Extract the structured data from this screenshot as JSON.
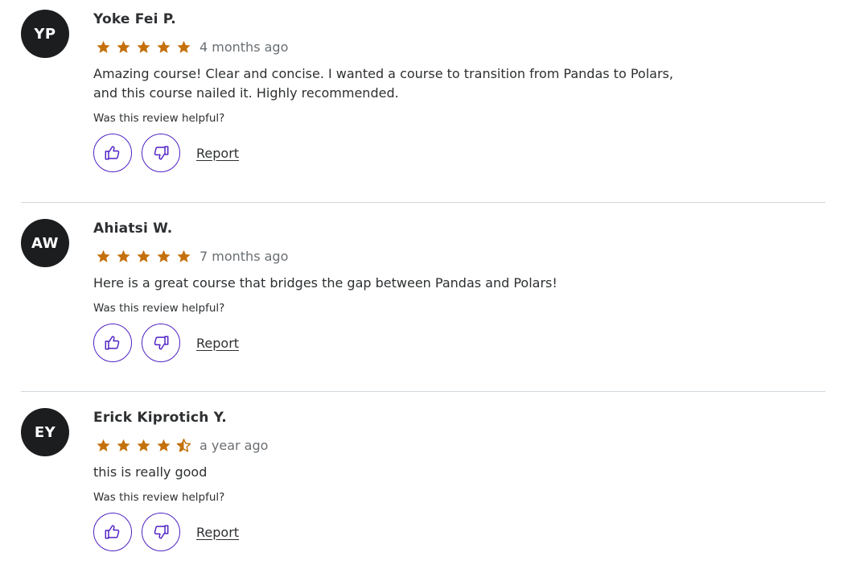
{
  "accent_color": "#5022c3",
  "star_color": "#c4710d",
  "avatar_color": "#1c1d1f",
  "reviews": [
    {
      "initials": "YP",
      "name": "Yoke Fei P.",
      "rating": 5,
      "date": "4 months ago",
      "text": "Amazing course! Clear and concise. I wanted a course to transition from Pandas to Polars, and this course nailed it. Highly recommended.",
      "helpful_prompt": "Was this review helpful?",
      "thumbs_up_icon": "thumbs-up-icon",
      "thumbs_down_icon": "thumbs-down-icon",
      "report_label": "Report"
    },
    {
      "initials": "AW",
      "name": "Ahiatsi W.",
      "rating": 5,
      "date": "7 months ago",
      "text": "Here is a great course that bridges the gap between Pandas and Polars!",
      "helpful_prompt": "Was this review helpful?",
      "thumbs_up_icon": "thumbs-up-icon",
      "thumbs_down_icon": "thumbs-down-icon",
      "report_label": "Report"
    },
    {
      "initials": "EY",
      "name": "Erick Kiprotich Y.",
      "rating": 4.5,
      "date": "a year ago",
      "text": "this is really good",
      "helpful_prompt": "Was this review helpful?",
      "thumbs_up_icon": "thumbs-up-icon",
      "thumbs_down_icon": "thumbs-down-icon",
      "report_label": "Report"
    }
  ]
}
